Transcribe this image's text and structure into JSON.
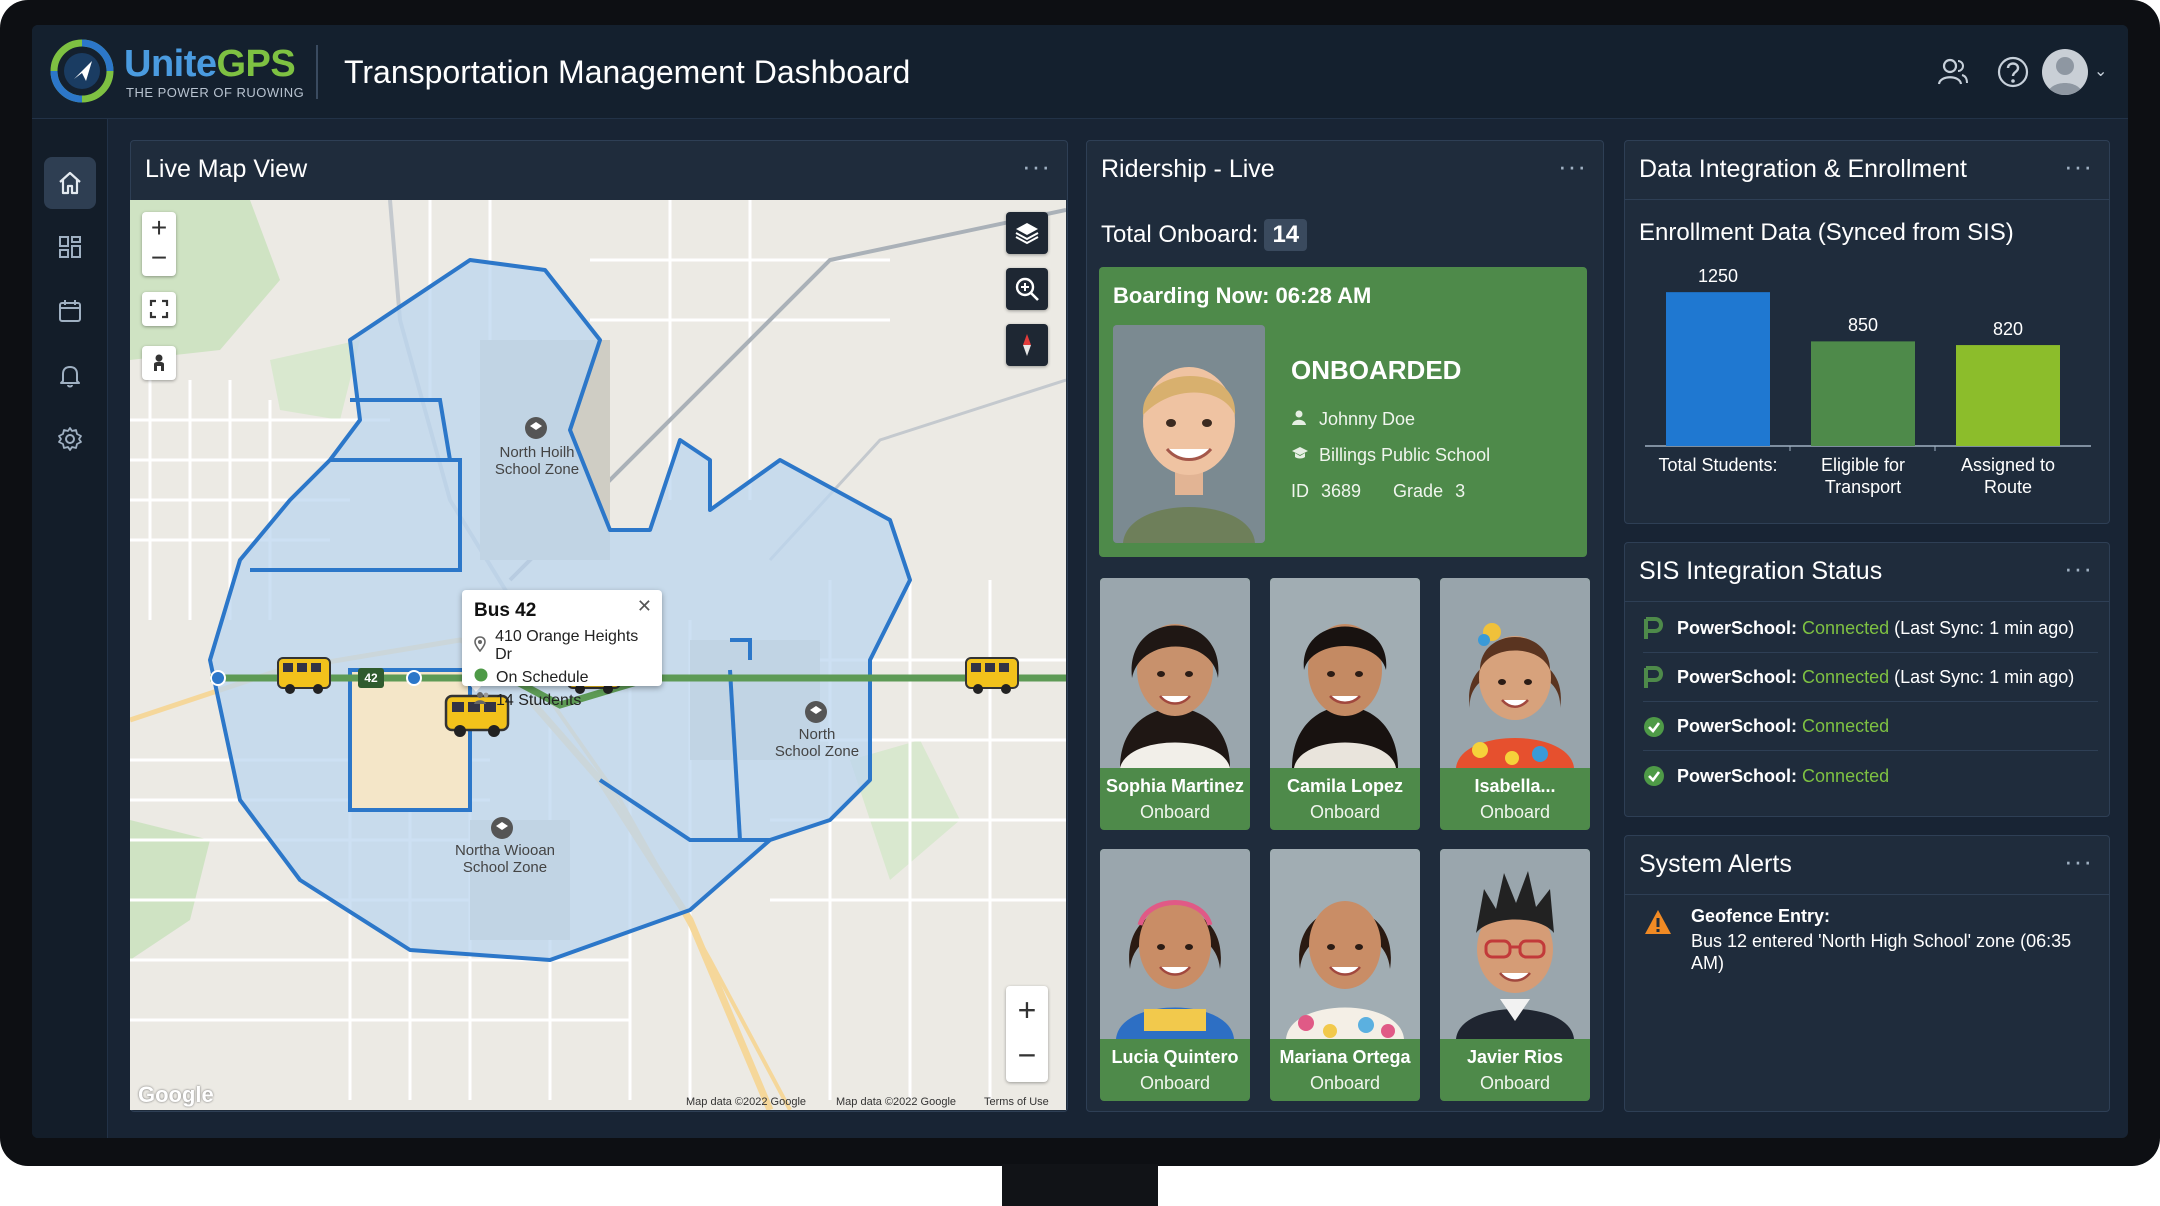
{
  "header": {
    "brand_part1": "Unite",
    "brand_part2": "GPS",
    "tagline": "THE POWER OF RUOWING",
    "title": "Transportation Management Dashboard",
    "icons": [
      "users-icon",
      "help-icon",
      "user-avatar",
      "chevron-down-icon"
    ]
  },
  "sidebar": {
    "items": [
      {
        "icon": "home-icon",
        "active": true
      },
      {
        "icon": "dashboard-grid-icon",
        "active": false
      },
      {
        "icon": "calendar-icon",
        "active": false
      },
      {
        "icon": "bell-icon",
        "active": false
      },
      {
        "icon": "gear-icon",
        "active": false
      }
    ]
  },
  "map_panel": {
    "title": "Live Map View",
    "more": "···",
    "popup": {
      "title": "Bus 42",
      "address": "410 Orange Heights Dr",
      "status": "On Schedule",
      "students": "14 Students"
    },
    "zones": [
      {
        "line1": "North Hoilh",
        "line2": "School Zone"
      },
      {
        "line1": "North",
        "line2": "School Zone"
      },
      {
        "line1": "Northa Wiooan",
        "line2": "School Zone"
      }
    ],
    "route_badge": "42",
    "zoom_in": "+",
    "zoom_out": "−",
    "google": "Google",
    "attrib1": "Map data ©2022 Google",
    "attrib2": "Map data ©2022 Google",
    "attrib3": "Terms of Use",
    "colors": {
      "zone_stroke": "#2c77c9",
      "zone_fill": "#bcd6ef",
      "route": "#5d9a55",
      "bus": "#f2c21b"
    }
  },
  "ridership": {
    "title": "Ridership - Live",
    "more": "···",
    "total_label": "Total Onboard:",
    "total_value": "14",
    "boarding": {
      "time_label": "Boarding Now: 06:28 AM",
      "status": "ONBOARDED",
      "name": "Johnny Doe",
      "school": "Billings Public School",
      "id_label": "ID",
      "id_value": "3689",
      "grade_label": "Grade",
      "grade_value": "3"
    },
    "students": [
      {
        "name": "Sophia Martinez",
        "status": "Onboard"
      },
      {
        "name": "Camila Lopez",
        "status": "Onboard"
      },
      {
        "name": "Isabella...",
        "status": "Onboard"
      },
      {
        "name": "Lucia Quintero",
        "status": "Onboard"
      },
      {
        "name": "Mariana Ortega",
        "status": "Onboard"
      },
      {
        "name": "Javier Rios",
        "status": "Onboard"
      }
    ]
  },
  "enrollment": {
    "title": "Data Integration & Enrollment",
    "more": "···",
    "chart_data": {
      "type": "bar",
      "title": "Enrollment Data (Synced from SIS)",
      "categories": [
        "Total Students:",
        "Eligible for Transport",
        "Assigned to Route"
      ],
      "values": [
        1250,
        850,
        820
      ],
      "value_labels": [
        "1250",
        "850",
        "820"
      ],
      "colors": [
        "#1f78d1",
        "#4e8a4a",
        "#8cbd2b"
      ],
      "ylim": [
        0,
        1300
      ],
      "grid": false
    },
    "category_lines": [
      [
        "Total Students:"
      ],
      [
        "Eligible for",
        "Transport"
      ],
      [
        "Assigned to",
        "Route"
      ]
    ]
  },
  "sis": {
    "title": "SIS Integration Status",
    "more": "···",
    "rows": [
      {
        "icon": "powerschool-icon",
        "name": "PowerSchool:",
        "status": "Connected",
        "extra": "(Last Sync: 1 min ago)"
      },
      {
        "icon": "powerschool-icon",
        "name": "PowerSchool:",
        "status": "Connected",
        "extra": "(Last Sync: 1 min ago)"
      },
      {
        "icon": "check-circle-icon",
        "name": "PowerSchool:",
        "status": "Connected",
        "extra": ""
      },
      {
        "icon": "check-circle-icon",
        "name": "PowerSchool:",
        "status": "Connected",
        "extra": ""
      }
    ]
  },
  "alerts": {
    "title": "System Alerts",
    "more": "···",
    "items": [
      {
        "icon": "warning-icon",
        "title": "Geofence Entry:",
        "body": "Bus 12 entered 'North High School' zone (06:35 AM)"
      }
    ]
  }
}
